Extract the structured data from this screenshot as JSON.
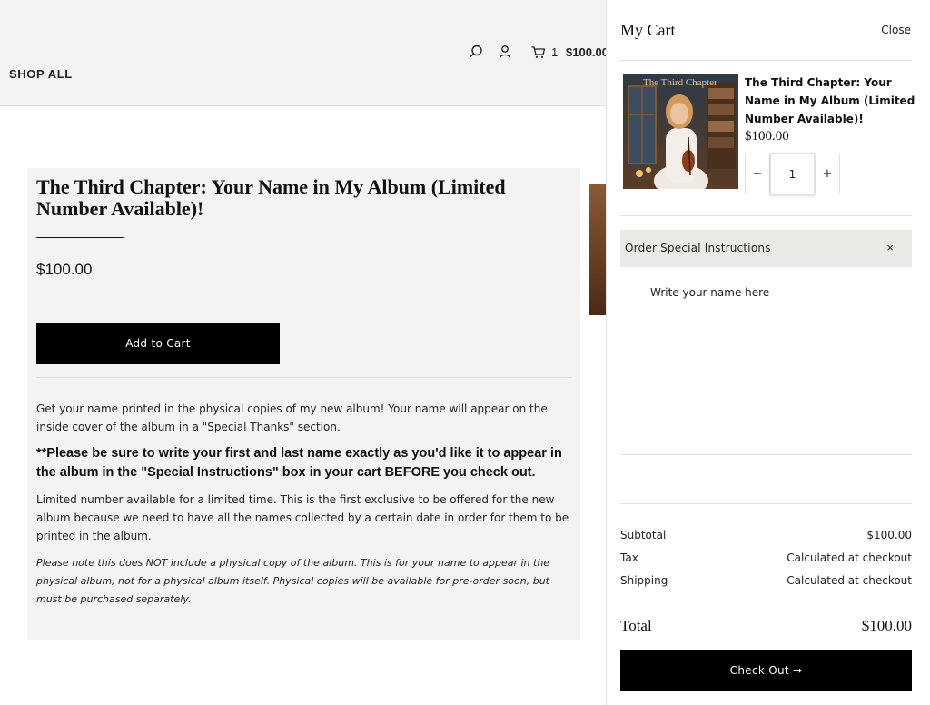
{
  "header": {
    "nav_shop_all": "SHOP ALL",
    "cart_count": "1",
    "cart_total": "$100.00",
    "icons": [
      "search-icon",
      "account-icon",
      "cart-icon"
    ]
  },
  "product": {
    "title": "The Third Chapter: Your Name in My Album (Limited Number Available)!",
    "price": "$100.00",
    "add_to_cart_label": "Add to Cart",
    "description_1": "Get your name printed in the physical copies of my new album!  Your name will appear on the inside cover of the album in a \"Special Thanks\" section.",
    "description_bold": "**Please be sure to write your first and last name exactly as you'd like it to appear in the album in the \"Special Instructions\" box in your cart BEFORE you check out.",
    "description_3": "Limited number available for a limited time.  This is the first exclusive to be offered for the new album because we need to have all the names collected by a certain date in order for them to be printed in the album.",
    "description_italic": "Please note this does NOT include a physical copy of the album. This is for your name to appear in the physical album, not for a physical album itself. Physical copies will be available for pre-order soon, but must be purchased separately."
  },
  "cart_drawer": {
    "title": "My Cart",
    "close_label": "Close",
    "item": {
      "album_art_text": "The Third Chapter",
      "name": "The Third Chapter: Your Name in My Album (Limited Number Available)!",
      "price": "$100.00",
      "quantity": "1",
      "decrement_symbol": "−",
      "increment_symbol": "+"
    },
    "instructions": {
      "label": "Order Special Instructions",
      "toggle_symbol": "×",
      "placeholder": "Write your name here"
    },
    "summary": {
      "subtotal_label": "Subtotal",
      "subtotal_value": "$100.00",
      "tax_label": "Tax",
      "tax_value": "Calculated at checkout",
      "shipping_label": "Shipping",
      "shipping_value": "Calculated at checkout",
      "total_label": "Total",
      "total_value": "$100.00"
    },
    "checkout_label": "Check Out ➞"
  }
}
